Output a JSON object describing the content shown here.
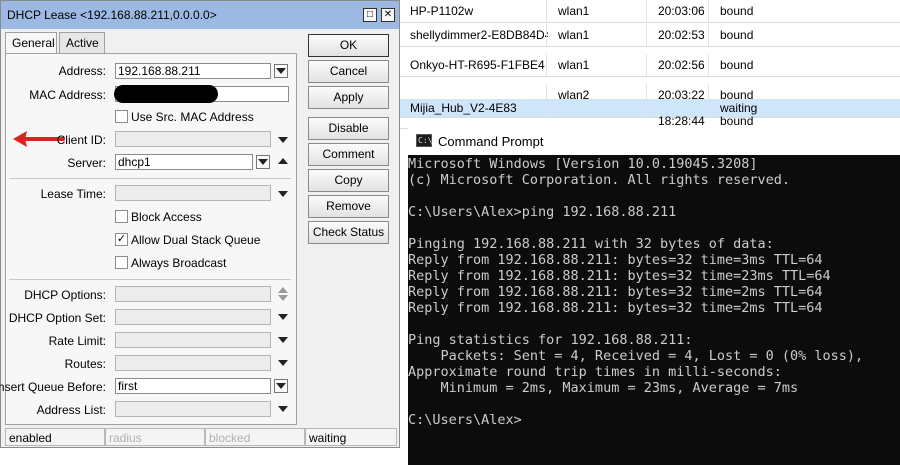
{
  "lease_table": {
    "rows": [
      {
        "host": "HP-P1102w",
        "interface": "wlan1",
        "time": "20:03:06",
        "status": "bound",
        "selected": false
      },
      {
        "host": "shellydimmer2-E8DB84D4...",
        "interface": "wlan1",
        "time": "20:02:53",
        "status": "bound",
        "selected": false
      },
      {
        "host": "Onkyo-HT-R695-F1FBE4",
        "interface": "wlan1",
        "time": "20:02:56",
        "status": "bound",
        "selected": false
      },
      {
        "host": "",
        "interface": "wlan2",
        "time": "20:03:22",
        "status": "bound",
        "selected": false
      },
      {
        "host": "Mijia_Hub_V2-4E83",
        "interface": "",
        "time": "",
        "status": "waiting",
        "selected": true
      },
      {
        "host": "",
        "interface": "",
        "time": "18:28:44",
        "status": "bound",
        "selected": false
      }
    ]
  },
  "dhcp_window": {
    "title": "DHCP Lease <192.168.88.211,0.0.0.0>",
    "title_buttons": {
      "minimize": "□",
      "close": "✕"
    },
    "tabs": [
      {
        "label": "General",
        "active": true
      },
      {
        "label": "Active",
        "active": false
      }
    ],
    "fields": {
      "address": {
        "label": "Address:",
        "value": "192.168.88.211"
      },
      "mac_address": {
        "label": "MAC Address:",
        "value": ""
      },
      "use_src_mac": {
        "label": "Use Src. MAC Address",
        "checked": false
      },
      "client_id": {
        "label": "Client ID:",
        "value": ""
      },
      "server": {
        "label": "Server:",
        "value": "dhcp1"
      },
      "lease_time": {
        "label": "Lease Time:",
        "value": ""
      },
      "block_access": {
        "label": "Block Access",
        "checked": false
      },
      "allow_dual_stack": {
        "label": "Allow Dual Stack Queue",
        "checked": true
      },
      "always_broadcast": {
        "label": "Always Broadcast",
        "checked": false
      },
      "dhcp_options": {
        "label": "DHCP Options:",
        "value": ""
      },
      "dhcp_option_set": {
        "label": "DHCP Option Set:",
        "value": ""
      },
      "rate_limit": {
        "label": "Rate Limit:",
        "value": ""
      },
      "routes": {
        "label": "Routes:",
        "value": ""
      },
      "insert_queue_before": {
        "label": "Insert Queue Before:",
        "value": "first"
      },
      "address_list": {
        "label": "Address List:",
        "value": ""
      }
    },
    "buttons": [
      "OK",
      "Cancel",
      "Apply",
      "Disable",
      "Comment",
      "Copy",
      "Remove",
      "Check Status"
    ],
    "status_bar": [
      "enabled",
      "radius",
      "blocked",
      "waiting"
    ],
    "checkmark": "✓"
  },
  "command_prompt": {
    "title": "Command Prompt",
    "icon": "C:\\",
    "lines": [
      "Microsoft Windows [Version 10.0.19045.3208]",
      "(c) Microsoft Corporation. All rights reserved.",
      "",
      "C:\\Users\\Alex>ping 192.168.88.211",
      "",
      "Pinging 192.168.88.211 with 32 bytes of data:",
      "Reply from 192.168.88.211: bytes=32 time=3ms TTL=64",
      "Reply from 192.168.88.211: bytes=32 time=23ms TTL=64",
      "Reply from 192.168.88.211: bytes=32 time=2ms TTL=64",
      "Reply from 192.168.88.211: bytes=32 time=2ms TTL=64",
      "",
      "Ping statistics for 192.168.88.211:",
      "    Packets: Sent = 4, Received = 4, Lost = 0 (0% loss),",
      "Approximate round trip times in milli-seconds:",
      "    Minimum = 2ms, Maximum = 23ms, Average = 7ms",
      "",
      "C:\\Users\\Alex>"
    ]
  },
  "colors": {
    "titlebar": "#9bb9e2",
    "selected_row": "#cfe5fa",
    "arrow": "#e02020",
    "console_bg": "#0c0c0c",
    "console_text": "#cccccc"
  }
}
